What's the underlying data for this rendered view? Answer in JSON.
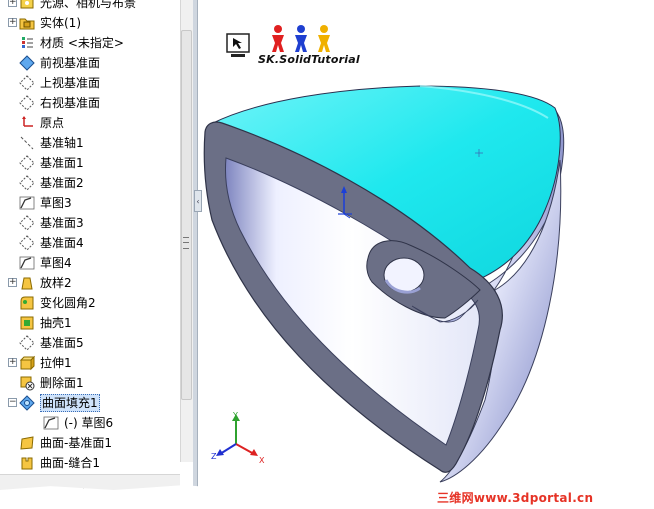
{
  "feature_tree": {
    "items": [
      {
        "label": "光源、相机与布景",
        "icon": "lights-cameras-scenes-icon",
        "expander": "+",
        "indent": 0
      },
      {
        "label": "实体(1)",
        "icon": "solid-bodies-folder-icon",
        "expander": "+",
        "indent": 0
      },
      {
        "label": "材质 <未指定>",
        "icon": "material-icon",
        "expander": "",
        "indent": 0
      },
      {
        "label": "前视基准面",
        "icon": "front-plane-icon",
        "expander": "",
        "indent": 0
      },
      {
        "label": "上视基准面",
        "icon": "plane-icon",
        "expander": "",
        "indent": 0
      },
      {
        "label": "右视基准面",
        "icon": "plane-icon",
        "expander": "",
        "indent": 0
      },
      {
        "label": "原点",
        "icon": "origin-icon",
        "expander": "",
        "indent": 0
      },
      {
        "label": "基准轴1",
        "icon": "axis-icon",
        "expander": "",
        "indent": 0
      },
      {
        "label": "基准面1",
        "icon": "plane-icon",
        "expander": "",
        "indent": 0
      },
      {
        "label": "基准面2",
        "icon": "plane-icon",
        "expander": "",
        "indent": 0
      },
      {
        "label": "草图3",
        "icon": "sketch-icon",
        "expander": "",
        "indent": 0
      },
      {
        "label": "基准面3",
        "icon": "plane-icon",
        "expander": "",
        "indent": 0
      },
      {
        "label": "基准面4",
        "icon": "plane-icon",
        "expander": "",
        "indent": 0
      },
      {
        "label": "草图4",
        "icon": "sketch-icon",
        "expander": "",
        "indent": 0
      },
      {
        "label": "放样2",
        "icon": "loft-icon",
        "expander": "+",
        "indent": 0
      },
      {
        "label": "变化圆角2",
        "icon": "variable-fillet-icon",
        "expander": "",
        "indent": 0
      },
      {
        "label": "抽壳1",
        "icon": "shell-icon",
        "expander": "",
        "indent": 0
      },
      {
        "label": "基准面5",
        "icon": "plane-icon",
        "expander": "",
        "indent": 0
      },
      {
        "label": "拉伸1",
        "icon": "extrude-icon",
        "expander": "+",
        "indent": 0
      },
      {
        "label": "删除面1",
        "icon": "delete-face-icon",
        "expander": "",
        "indent": 0
      },
      {
        "label": "曲面填充1",
        "icon": "surface-fill-icon",
        "expander": "−",
        "indent": 0,
        "selected": true
      },
      {
        "label": "(-) 草图6",
        "icon": "sketch-icon",
        "expander": "",
        "indent": 1
      },
      {
        "label": "曲面-基准面1",
        "icon": "planar-surface-icon",
        "expander": "",
        "indent": 0
      },
      {
        "label": "曲面-缝合1",
        "icon": "knit-surface-icon",
        "expander": "",
        "indent": 0
      }
    ]
  },
  "logo": {
    "text": "SK.SolidTutorial"
  },
  "watermark": {
    "text": "三维网www.3dportal.cn"
  },
  "triad": {
    "x": "X",
    "y": "Y",
    "z": "Z"
  },
  "colors": {
    "fill_surface": "#1fe8ee",
    "shell_edge": "#6b6f86",
    "body_light": "#eef0fb",
    "body_shadow": "#8c93c8",
    "selection": "#cfe3fb",
    "watermark": "#e63326"
  }
}
